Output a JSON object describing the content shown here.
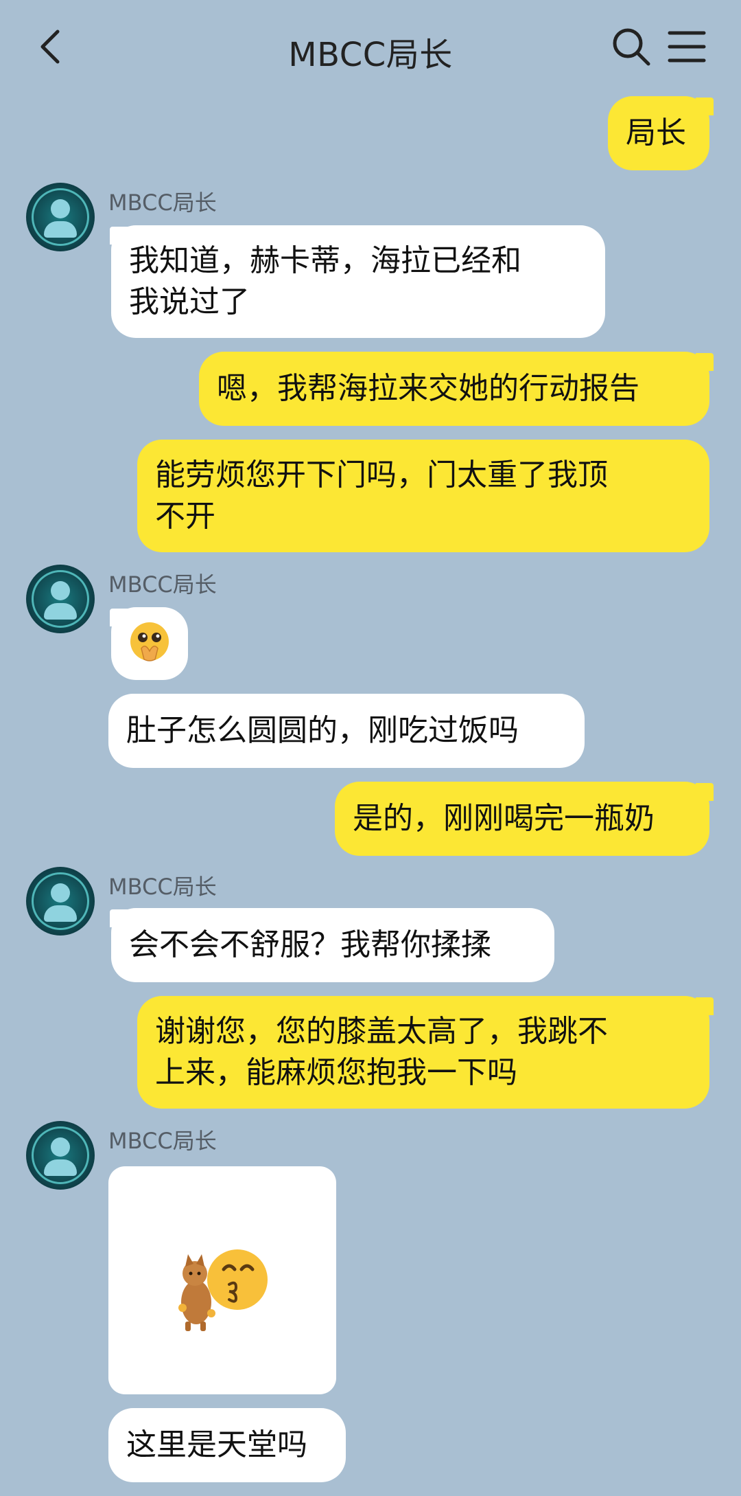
{
  "header": {
    "title": "MBCC局长",
    "back_icon": "chevron-left-icon",
    "search_icon": "search-icon",
    "menu_icon": "menu-icon"
  },
  "colors": {
    "background": "#a9bfd2",
    "outgoing_bubble": "#fce734",
    "incoming_bubble": "#ffffff"
  },
  "messages": [
    {
      "direction": "out",
      "text": "局长"
    },
    {
      "direction": "in",
      "sender": "MBCC局长",
      "lines": [
        "我知道，赫卡蒂，海拉已经和",
        "我说过了"
      ]
    },
    {
      "direction": "out",
      "text": "嗯，我帮海拉来交她的行动报告"
    },
    {
      "direction": "out",
      "lines": [
        "能劳烦您开下门吗，门太重了我顶",
        "不开"
      ]
    },
    {
      "direction": "in",
      "sender": "MBCC局长",
      "emoji": "pleading-hands-emoji"
    },
    {
      "direction": "in",
      "text": "肚子怎么圆圆的，刚吃过饭吗"
    },
    {
      "direction": "out",
      "text": "是的，刚刚喝完一瓶奶"
    },
    {
      "direction": "in",
      "sender": "MBCC局长",
      "text": "会不会不舒服？我帮你揉揉"
    },
    {
      "direction": "out",
      "lines": [
        "谢谢您，您的膝盖太高了，我跳不",
        "上来，能麻烦您抱我一下吗"
      ]
    },
    {
      "direction": "in",
      "sender": "MBCC局长",
      "sticker": "cat-and-kissing-face-sticker"
    },
    {
      "direction": "in",
      "text": "这里是天堂吗"
    }
  ]
}
